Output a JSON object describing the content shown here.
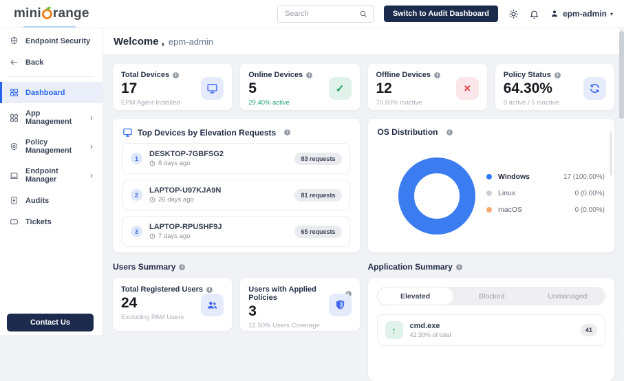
{
  "header": {
    "logo_part1": "mini",
    "logo_part2": "range",
    "search_placeholder": "Search",
    "switch_button": "Switch to Audit Dashboard",
    "user": "epm-admin",
    "icons": {
      "theme": "sun-icon",
      "notifications": "bell-icon",
      "account": "person-icon"
    }
  },
  "sidebar": {
    "endpoint_security": "Endpoint Security",
    "back": "Back",
    "items": [
      {
        "label": "Dashboard",
        "icon": "dashboard-grid-icon",
        "active": true
      },
      {
        "label": "App Management",
        "icon": "app-grid-icon",
        "chevron": "›"
      },
      {
        "label": "Policy Management",
        "icon": "policy-shield-icon",
        "chevron": "›"
      },
      {
        "label": "Endpoint Manager",
        "icon": "laptop-icon",
        "chevron": "›"
      },
      {
        "label": "Audits",
        "icon": "document-icon"
      },
      {
        "label": "Tickets",
        "icon": "ticket-icon"
      }
    ],
    "chevron_glyph": "›",
    "contact_button": "Contact Us"
  },
  "welcome": {
    "title": "Welcome ,",
    "user": "epm-admin"
  },
  "stats": [
    {
      "label": "Total Devices",
      "value": "17",
      "subtitle": "EPM Agent Installed",
      "icon": "monitor-icon",
      "icon_color": "#4169e8",
      "icon_bg": "#e6ebfc"
    },
    {
      "label": "Online Devices",
      "value": "5",
      "subtitle": "29.40% active",
      "icon": "check-icon",
      "icon_color": "#1f9d5f",
      "icon_bg": "#e1f2ea",
      "glyph": "✓"
    },
    {
      "label": "Offline Devices",
      "value": "12",
      "subtitle": "70.60% inactive",
      "icon": "cross-icon",
      "icon_color": "#e0343c",
      "icon_bg": "#fbe7e9",
      "glyph": "✕"
    },
    {
      "label": "Policy Status",
      "value": "64.30%",
      "subtitle": "9 active / 5 inactive",
      "icon": "sync-icon",
      "icon_color": "#4169e8",
      "icon_bg": "#e6ebfc"
    }
  ],
  "top_devices": {
    "title": "Top Devices by Elevation Requests",
    "title_icon": "monitor-icon",
    "rows": [
      {
        "rank": "1",
        "name": "DESKTOP-7GBFSG2",
        "ago": "8 days ago",
        "requests": "83 requests"
      },
      {
        "rank": "2",
        "name": "LAPTOP-U97KJA9N",
        "ago": "26 days ago",
        "requests": "81 requests"
      },
      {
        "rank": "3",
        "name": "LAPTOP-RPUSHF9J",
        "ago": "7 days ago",
        "requests": "65 requests"
      }
    ]
  },
  "os_distribution": {
    "title": "OS Distribution",
    "donut_color": "#3b7cf0",
    "legend": [
      {
        "name": "Windows",
        "value": "17 (100.00%)",
        "color": "#2f7bf6"
      },
      {
        "name": "Linux",
        "value": "0 (0.00%)",
        "color": "#c9ced6"
      },
      {
        "name": "macOS",
        "value": "0 (0.00%)",
        "color": "#f6a96f"
      }
    ]
  },
  "users_summary": {
    "title": "Users Summary",
    "cards": [
      {
        "label": "Total Registered Users",
        "value": "24",
        "subtitle": "Excluding PAM Users",
        "icon": "users-icon",
        "icon_color": "#4169e8",
        "icon_bg": "#e6ebfc"
      },
      {
        "label": "Users with Applied Policies",
        "value": "3",
        "subtitle": "12.50% Users Coverage",
        "icon": "shield-check-icon",
        "icon_color": "#4169e8",
        "icon_bg": "#e6ebfc"
      }
    ]
  },
  "application_summary": {
    "title": "Application Summary",
    "tabs": [
      {
        "label": "Elevated",
        "active": true
      },
      {
        "label": "Blocked"
      },
      {
        "label": "Unmanaged"
      }
    ],
    "items": [
      {
        "name": "cmd.exe",
        "subtitle": "42.30% of total",
        "count": "41",
        "icon": "arrow-up-icon",
        "glyph": "↑"
      }
    ]
  },
  "colors": {
    "accent_blue": "#2f6bf5",
    "navy_button": "#1c2b4d",
    "brand_orange": "#f0831f",
    "brand_leaf_green": "#7ac143",
    "success_green": "#27a376",
    "danger_red": "#e0343c",
    "page_bg": "#f1f2f5",
    "active_nav_bg": "#e9eef8"
  }
}
